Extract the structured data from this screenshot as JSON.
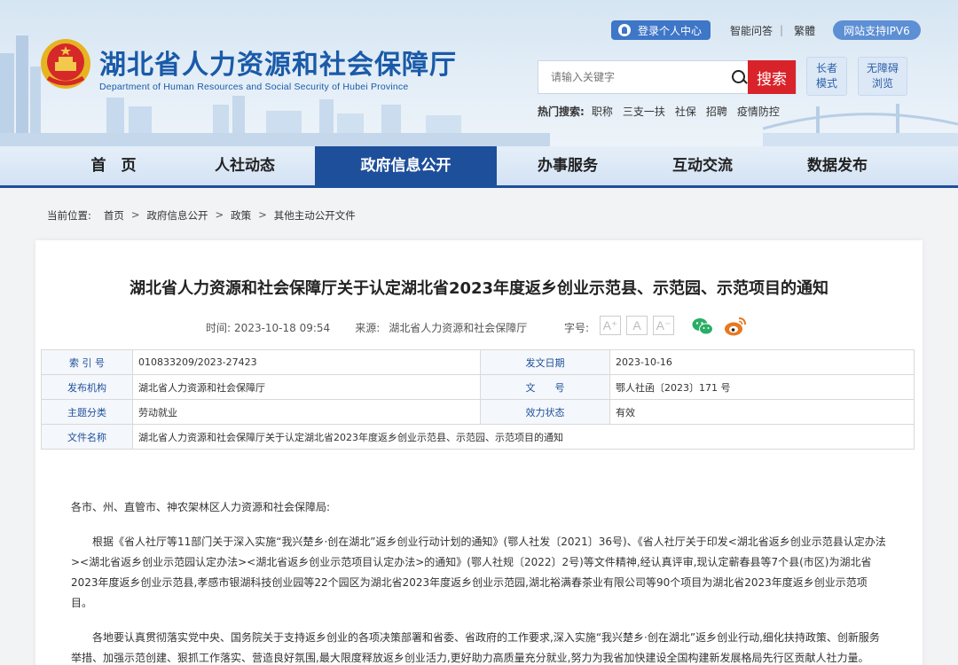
{
  "header": {
    "site_title": "湖北省人力资源和社会保障厅",
    "site_subtitle": "Department of Human Resources and Social Security of Hubei Province",
    "personal_center": "登录个人中心",
    "smart_qa": "智能问答",
    "separator": "|",
    "traditional": "繁體",
    "ipv6": "网站支持IPV6",
    "search_placeholder": "请输入关键字",
    "search_button": "搜索",
    "hot_label": "热门搜索:",
    "hot_terms": [
      "职称",
      "三支一扶",
      "社保",
      "招聘",
      "疫情防控"
    ],
    "elder_mode": [
      "长者",
      "模式"
    ],
    "accessible": [
      "无障碍",
      "浏览"
    ]
  },
  "nav": {
    "items": [
      "首　页",
      "人社动态",
      "政府信息公开",
      "办事服务",
      "互动交流",
      "数据发布"
    ],
    "active_index": 2
  },
  "breadcrumb": {
    "label": "当前位置:",
    "items": [
      "首页",
      "政府信息公开",
      "政策",
      "其他主动公开文件"
    ],
    "sep": ">"
  },
  "article": {
    "title": "湖北省人力资源和社会保障厅关于认定湖北省2023年度返乡创业示范县、示范园、示范项目的通知",
    "time_label": "时间:",
    "time": "2023-10-18 09:54",
    "source_label": "来源:",
    "source": "湖北省人力资源和社会保障厅",
    "font_size_label": "字号:",
    "font_sizes": [
      "A⁺",
      "A",
      "A⁻"
    ],
    "info": {
      "index_label": "索 引 号",
      "index": "010833209/2023-27423",
      "date_label": "发文日期",
      "date": "2023-10-16",
      "org_label": "发布机构",
      "org": "湖北省人力资源和社会保障厅",
      "docno_label": "文　　号",
      "docno": "鄂人社函〔2023〕171 号",
      "topic_label": "主题分类",
      "topic": "劳动就业",
      "status_label": "效力状态",
      "status": "有效",
      "name_label": "文件名称",
      "name": "湖北省人力资源和社会保障厅关于认定湖北省2023年度返乡创业示范县、示范园、示范项目的通知"
    },
    "salutation": "各市、州、直管市、神农架林区人力资源和社会保障局:",
    "para1": "根据《省人社厅等11部门关于深入实施“我兴楚乡·创在湖北”返乡创业行动计划的通知》(鄂人社发〔2021〕36号)、《省人社厅关于印发<湖北省返乡创业示范县认定办法><湖北省返乡创业示范园认定办法><湖北省返乡创业示范项目认定办法>的通知》(鄂人社规〔2022〕2号)等文件精神,经认真评审,现认定蕲春县等7个县(市区)为湖北省2023年度返乡创业示范县,孝感市银湖科技创业园等22个园区为湖北省2023年度返乡创业示范园,湖北裕满春茶业有限公司等90个项目为湖北省2023年度返乡创业示范项目。",
    "para2": "各地要认真贯彻落实党中央、国务院关于支持返乡创业的各项决策部署和省委、省政府的工作要求,深入实施“我兴楚乡·创在湖北”返乡创业行动,细化扶持政策、创新服务举措、加强示范创建、狠抓工作落实、营造良好氛围,最大限度释放返乡创业活力,更好助力高质量充分就业,努力为我省加快建设全国构建新发展格局先行区贡献人社力量。"
  },
  "colors": {
    "brand_blue": "#1e4f9b",
    "search_red": "#d9232a",
    "wechat_green": "#2aae67",
    "weibo_orange": "#e8781f"
  }
}
